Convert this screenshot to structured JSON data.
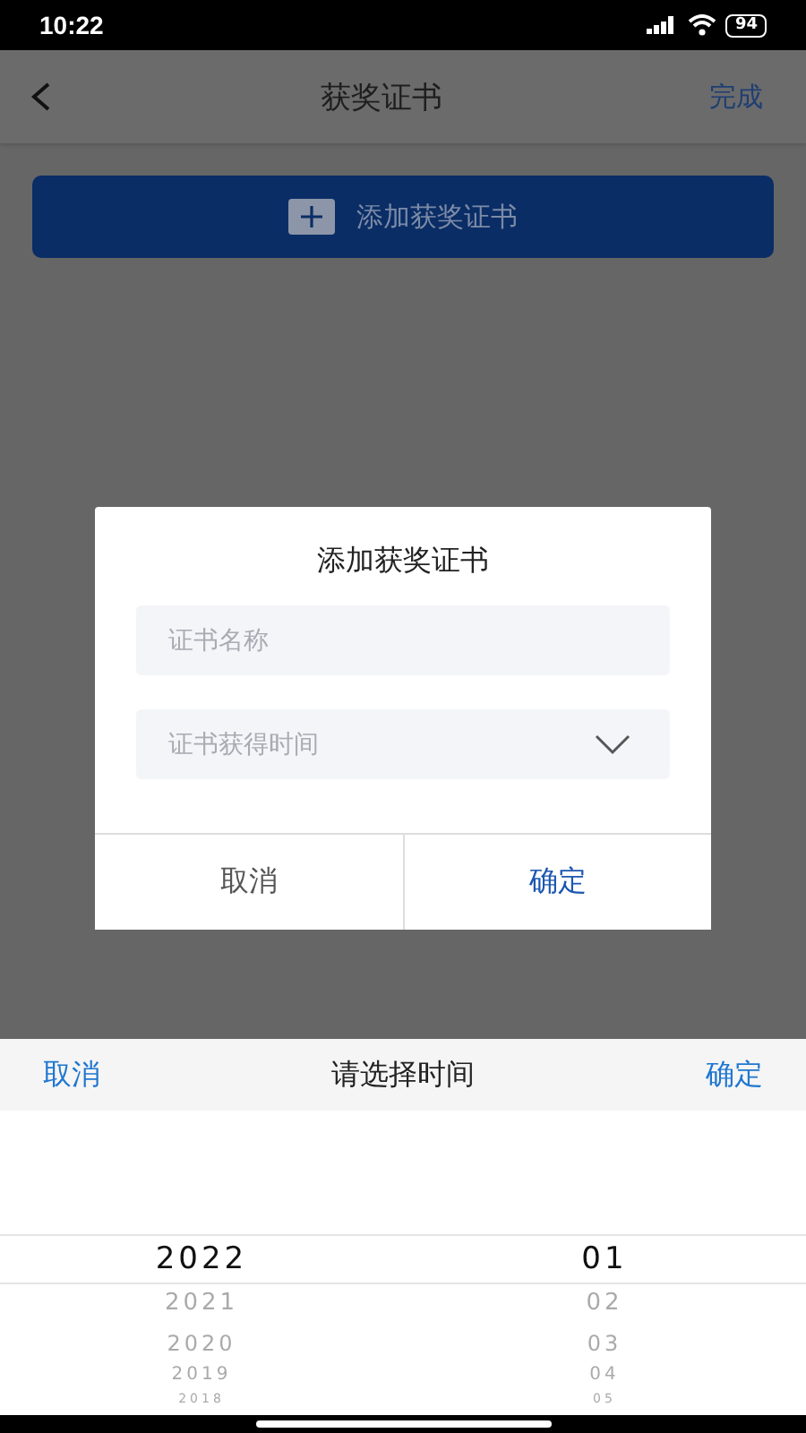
{
  "status_bar": {
    "time": "10:22",
    "battery": "94"
  },
  "nav": {
    "title": "获奖证书",
    "action": "完成"
  },
  "add_button": {
    "label": "添加获奖证书"
  },
  "dialog": {
    "title": "添加获奖证书",
    "fields": [
      {
        "kind": "text",
        "placeholder": "证书名称"
      },
      {
        "kind": "select",
        "placeholder": "证书获得时间"
      }
    ],
    "buttons": [
      {
        "kind": "cancel",
        "label": "取消"
      },
      {
        "kind": "confirm",
        "label": "确定"
      }
    ]
  },
  "picker": {
    "cancel": "取消",
    "title": "请选择时间",
    "confirm": "确定",
    "columns": [
      {
        "items": [
          {
            "label": "2022",
            "selected": true
          },
          {
            "label": "2021",
            "selected": false
          },
          {
            "label": "2020",
            "selected": false
          },
          {
            "label": "2019",
            "selected": false
          },
          {
            "label": "2018",
            "selected": false
          }
        ]
      },
      {
        "items": [
          {
            "label": "01",
            "selected": true
          },
          {
            "label": "02",
            "selected": false
          },
          {
            "label": "03",
            "selected": false
          },
          {
            "label": "04",
            "selected": false
          },
          {
            "label": "05",
            "selected": false
          }
        ]
      }
    ]
  }
}
